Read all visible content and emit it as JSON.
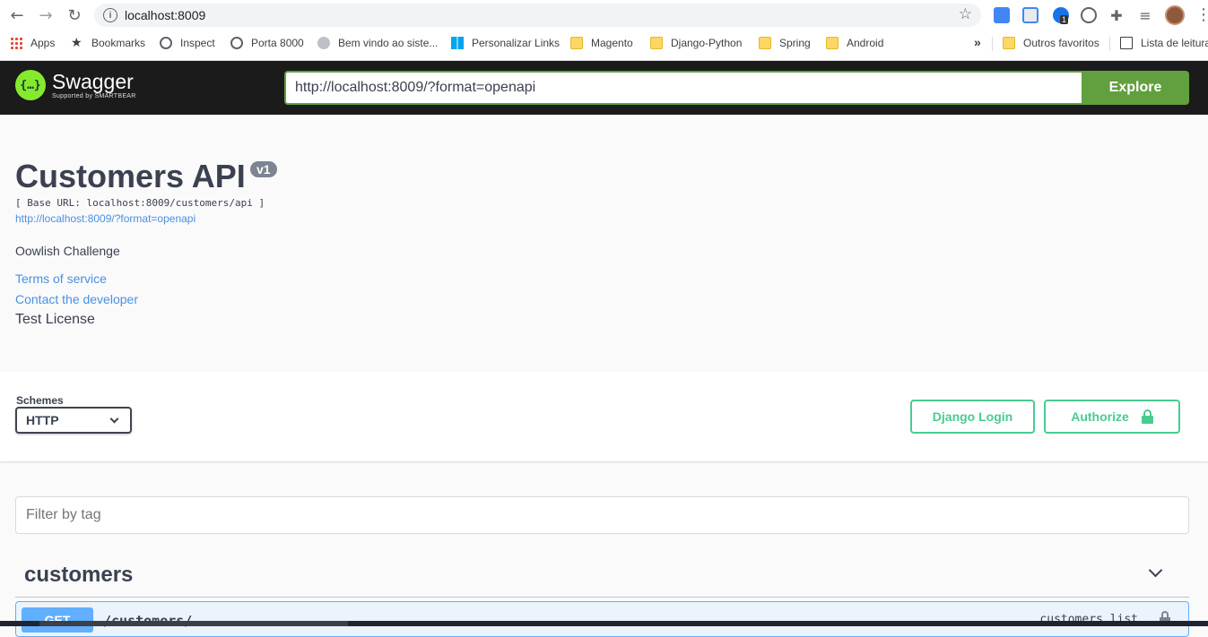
{
  "browser": {
    "url": "localhost:8009",
    "bookmarks": [
      {
        "label": "Apps",
        "icon": "apps-grid-icon"
      },
      {
        "label": "Bookmarks",
        "icon": "star-icon"
      },
      {
        "label": "Inspect",
        "icon": "globe-icon"
      },
      {
        "label": "Porta 8000",
        "icon": "globe-icon"
      },
      {
        "label": "Bem vindo ao siste...",
        "icon": "site-icon"
      },
      {
        "label": "Personalizar Links",
        "icon": "windows-icon"
      },
      {
        "label": "Magento",
        "icon": "folder-icon"
      },
      {
        "label": "Django-Python",
        "icon": "folder-icon"
      },
      {
        "label": "Spring",
        "icon": "folder-icon"
      },
      {
        "label": "Android",
        "icon": "folder-icon"
      }
    ],
    "more_label": "»",
    "other_favorites": "Outros favoritos",
    "reading_list": "Lista de leitura",
    "ext_badge": "1"
  },
  "topbar": {
    "logo_symbol": "{…}",
    "logo_title": "Swagger",
    "logo_sub": "Supported by SMARTBEAR",
    "spec_url": "http://localhost:8009/?format=openapi",
    "explore_label": "Explore",
    "brand_color": "#85ea2d",
    "accent_color": "#62a03f"
  },
  "info": {
    "title": "Customers API",
    "version": "v1",
    "base_url": "[ Base URL: localhost:8009/customers/api ]",
    "spec_link": "http://localhost:8009/?format=openapi",
    "description": "Oowlish Challenge",
    "terms": "Terms of service",
    "contact": "Contact the developer",
    "license": "Test License"
  },
  "schemes": {
    "label": "Schemes",
    "selected": "HTTP",
    "django_login_label": "Django Login",
    "authorize_label": "Authorize",
    "auth_color": "#49cc90"
  },
  "filter": {
    "placeholder": "Filter by tag"
  },
  "tags": [
    {
      "name": "customers",
      "operations": [
        {
          "method": "GET",
          "path": "/customers/",
          "operation_id": "customers_list",
          "color": "#61affe"
        }
      ]
    }
  ]
}
